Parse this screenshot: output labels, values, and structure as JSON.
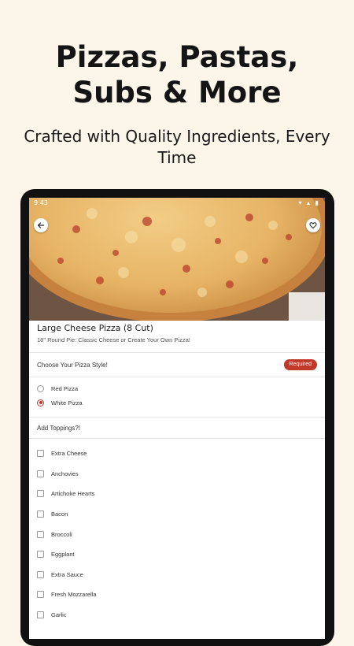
{
  "promo": {
    "headline_line1": "Pizzas, Pastas,",
    "headline_line2": "Subs & More",
    "subline_line1": "Crafted with Quality Ingredients, Every",
    "subline_line2": "Time"
  },
  "status_bar": {
    "time": "9:43",
    "icons": "▾ ▴ ▮"
  },
  "item": {
    "title": "Large Cheese Pizza (8 Cut)",
    "description": "18\" Round Pie: Classic Cheese or Create Your Own Pizza!"
  },
  "pizza_style": {
    "label": "Choose Your Pizza Style!",
    "badge": "Required",
    "options": [
      {
        "label": "Red Pizza",
        "selected": false
      },
      {
        "label": "White Pizza",
        "selected": true
      }
    ]
  },
  "toppings": {
    "label": "Add Toppings?!",
    "options": [
      {
        "label": "Extra Cheese",
        "checked": false
      },
      {
        "label": "Anchovies",
        "checked": false
      },
      {
        "label": "Artichoke Hearts",
        "checked": false
      },
      {
        "label": "Bacon",
        "checked": false
      },
      {
        "label": "Broccoli",
        "checked": false
      },
      {
        "label": "Eggplant",
        "checked": false
      },
      {
        "label": "Extra Sauce",
        "checked": false
      },
      {
        "label": "Fresh Mozzarella",
        "checked": false
      },
      {
        "label": "Garlic",
        "checked": false
      }
    ]
  },
  "colors": {
    "accent": "#c0392b",
    "background": "#fcf5ea"
  },
  "icons": {
    "back": "arrow-left-icon",
    "favorite": "heart-outline-icon"
  }
}
